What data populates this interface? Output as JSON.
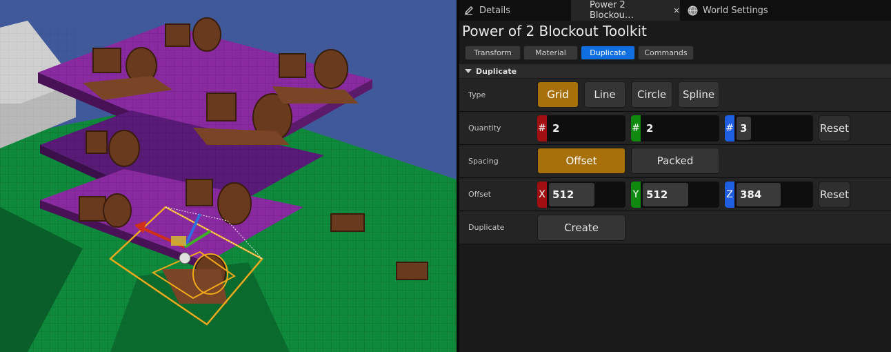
{
  "tabs": {
    "details": "Details",
    "toolkit": "Power 2 Blockou…",
    "toolkit_close": "×",
    "world": "World Settings"
  },
  "panel_title": "Power of 2 Blockout Toolkit",
  "subtabs": {
    "transform": "Transform",
    "material": "Material",
    "duplicate": "Duplicate",
    "commands": "Commands",
    "active": "Duplicate"
  },
  "section": {
    "title": "Duplicate"
  },
  "type_row": {
    "label": "Type",
    "options": [
      "Grid",
      "Line",
      "Circle",
      "Spline"
    ],
    "selected": "Grid"
  },
  "quantity_row": {
    "label": "Quantity",
    "prefix": "#",
    "x": "2",
    "y": "2",
    "z": "3",
    "reset": "Reset"
  },
  "spacing_row": {
    "label": "Spacing",
    "options": [
      "Offset",
      "Packed"
    ],
    "selected": "Offset"
  },
  "offset_row": {
    "label": "Offset",
    "x_tag": "X",
    "y_tag": "Y",
    "z_tag": "Z",
    "x": "512",
    "y": "512",
    "z": "384",
    "reset": "Reset"
  },
  "duplicate_row": {
    "label": "Duplicate",
    "button": "Create"
  },
  "colors": {
    "accent_active_tab": "#0f6fe0",
    "selected_option": "#a8700a",
    "axis_x": "#a01010",
    "axis_y": "#0f8a0f",
    "axis_z": "#1f5ee0"
  }
}
